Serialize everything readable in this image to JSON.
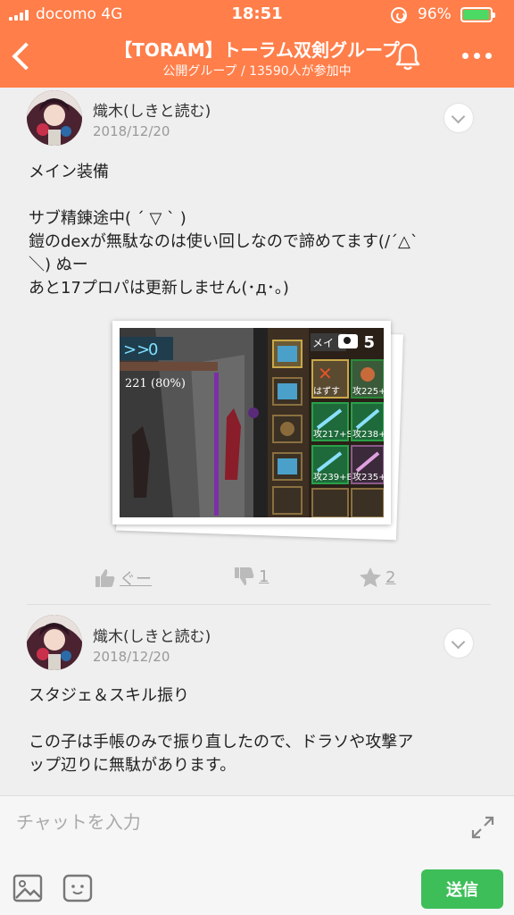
{
  "status_bar": {
    "carrier": "docomo  4G",
    "time": "18:51",
    "battery": "96%",
    "battery_level": 0.96
  },
  "header": {
    "title": "【TORAM】トーラム双剣グループ",
    "subtitle": "公開グループ / 13590人が参加中",
    "bg_color": "#ff7e4a"
  },
  "posts": [
    {
      "author": "熾木(しきと読む)",
      "date": "2018/12/20",
      "lines": [
        "メイン装備",
        "",
        "サブ精錬途中( ´ ▽ ` )",
        "鎧のdexが無駄なのは使い回しなので諦めてます(/´△`",
        "＼) ぬー",
        "あと17プロパは更新しません(･д･。)"
      ],
      "photo": {
        "count": "5",
        "hud_value": "0",
        "hud_hp": "221 (80%)",
        "menu_label": "メイ",
        "remove_label": "はずす",
        "items": [
          "攻225+",
          "攻217+S",
          "攻238+",
          "攻239+B",
          "攻235+"
        ]
      },
      "actions": {
        "like_label": "ぐー",
        "dislike_count": "1",
        "star_count": "2"
      }
    },
    {
      "author": "熾木(しきと読む)",
      "date": "2018/12/20",
      "lines": [
        "スタジェ＆スキル振り",
        "",
        "この子は手帳のみで振り直したので、ドラソや攻撃ア",
        "ップ辺りに無駄があります。"
      ]
    }
  ],
  "composer": {
    "placeholder": "チャットを入力",
    "send_label": "送信",
    "send_color": "#3dbe58"
  }
}
